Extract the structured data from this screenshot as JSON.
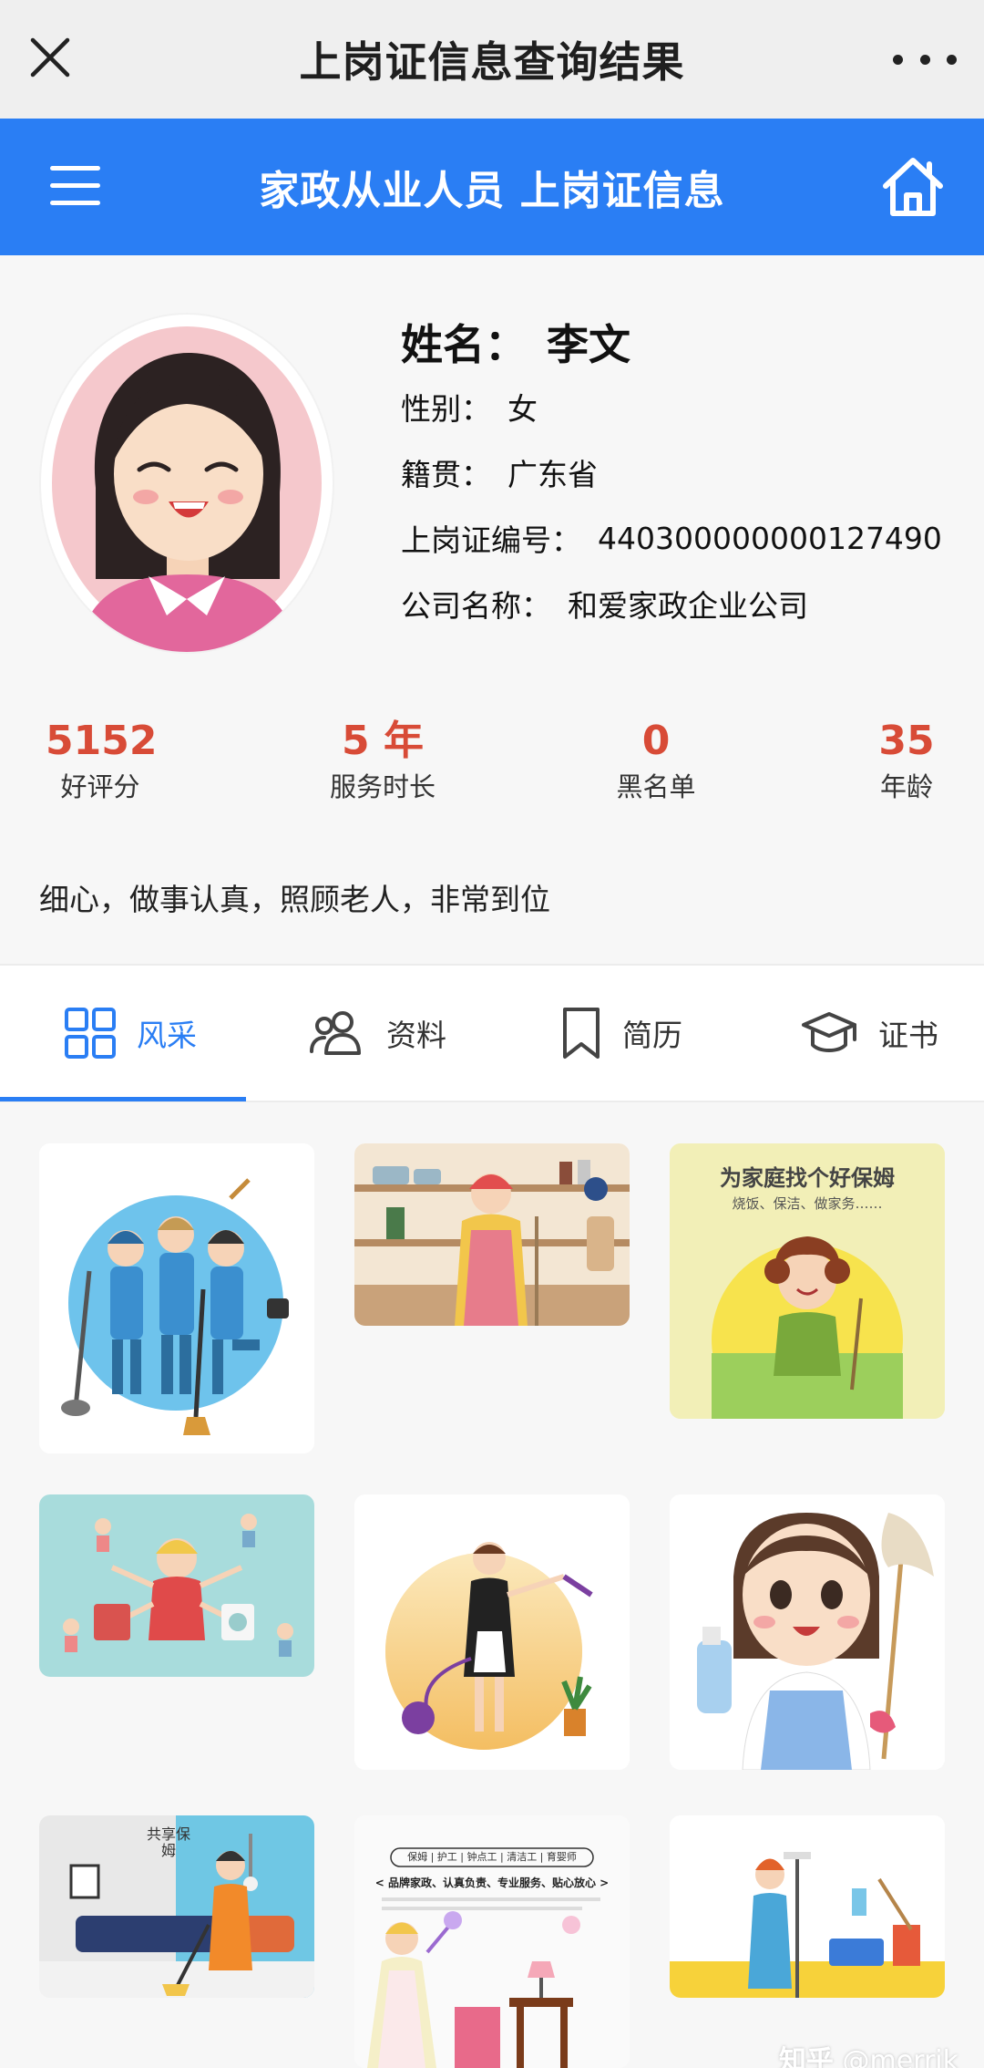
{
  "topbar": {
    "title": "上岗证信息查询结果"
  },
  "header": {
    "title": "家政从业人员 上岗证信息"
  },
  "profile": {
    "name_label": "姓名：",
    "name": "李文",
    "gender_label": "性别：",
    "gender": "女",
    "origin_label": "籍贯：",
    "origin": "广东省",
    "cert_label": "上岗证编号：",
    "cert_no": "440300000000127490",
    "company_label": "公司名称：",
    "company": "和爱家政企业公司"
  },
  "stats": [
    {
      "value": "5152",
      "label": "好评分"
    },
    {
      "value": "5 年",
      "label": "服务时长"
    },
    {
      "value": "0",
      "label": "黑名单"
    },
    {
      "value": "35",
      "label": "年龄"
    }
  ],
  "motto": "细心，做事认真，照顾老人，非常到位",
  "tabs": [
    {
      "label": "风采",
      "icon": "grid-icon",
      "active": true
    },
    {
      "label": "资料",
      "icon": "users-icon",
      "active": false
    },
    {
      "label": "简历",
      "icon": "bookmark-icon",
      "active": false
    },
    {
      "label": "证书",
      "icon": "graduation-cap-icon",
      "active": false
    }
  ],
  "gallery": {
    "card3_title": "为家庭找个好保姆",
    "card3_sub": "烧饭、保洁、做家务……",
    "card7_sign": "共享保姆",
    "card8_banner": "保姆 | 护工 | 钟点工 | 清洁工 | 育婴师",
    "card8_slogan": "< 品牌家政、认真负责、专业服务、贴心放心 >"
  },
  "watermark": {
    "site": "知乎",
    "user": "@merrik"
  },
  "colors": {
    "accent": "#2a7ef4",
    "stat": "#d84b37"
  }
}
